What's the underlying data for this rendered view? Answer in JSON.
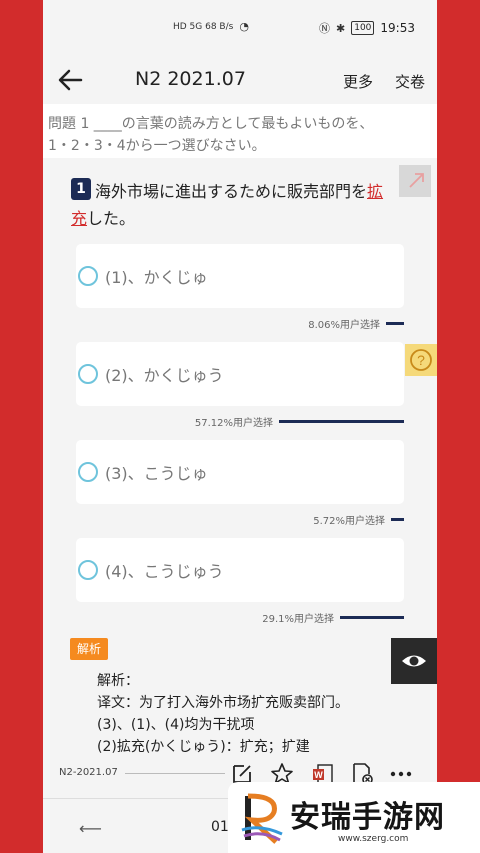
{
  "status": {
    "left": "HD 5G 68 B/s",
    "time": "19:53",
    "battery": "100"
  },
  "header": {
    "title": "N2 2021.07",
    "more": "更多",
    "submit": "交卷"
  },
  "instruction": {
    "line1": "問題 1 ____の言葉の読み方として最もよいものを、",
    "line2": "1・2・3・4から一つ選びなさい。"
  },
  "question": {
    "number": "1",
    "text_before": "海外市場に進出するために販売部門を",
    "word_part1": "拡",
    "word_part2": "充",
    "text_after": "した。"
  },
  "options": [
    {
      "label": "(1)、かくじゅ",
      "stat": "8.06%用户选择",
      "pct": 8.06
    },
    {
      "label": "(2)、かくじゅう",
      "stat": "57.12%用户选择",
      "pct": 57.12
    },
    {
      "label": "(3)、こうじゅ",
      "stat": "5.72%用户选择",
      "pct": 5.72
    },
    {
      "label": "(4)、こうじゅう",
      "stat": "29.1%用户选择",
      "pct": 29.1
    }
  ],
  "explanation": {
    "badge": "解析",
    "lines": [
      "解析：",
      "译文：为了打入海外市场扩充贩卖部门。",
      "(3)、(1)、(4)均为干扰项",
      "(2)拡充(かくじゅう)：扩充；扩建"
    ]
  },
  "footer": {
    "reference": "N2-2021.07",
    "page": "01/"
  },
  "watermark": {
    "name": "安瑞手游网",
    "url": "www.szerg.com"
  },
  "colors": {
    "accent_red": "#d22c2c",
    "navy": "#1c2b55",
    "radio": "#6fc4dc",
    "badge_orange": "#f58a1f"
  },
  "icons": [
    "back-arrow-icon",
    "share-icon",
    "help-icon",
    "eye-icon",
    "edit-icon",
    "star-icon",
    "word-icon",
    "delete-doc-icon",
    "more-icon"
  ]
}
